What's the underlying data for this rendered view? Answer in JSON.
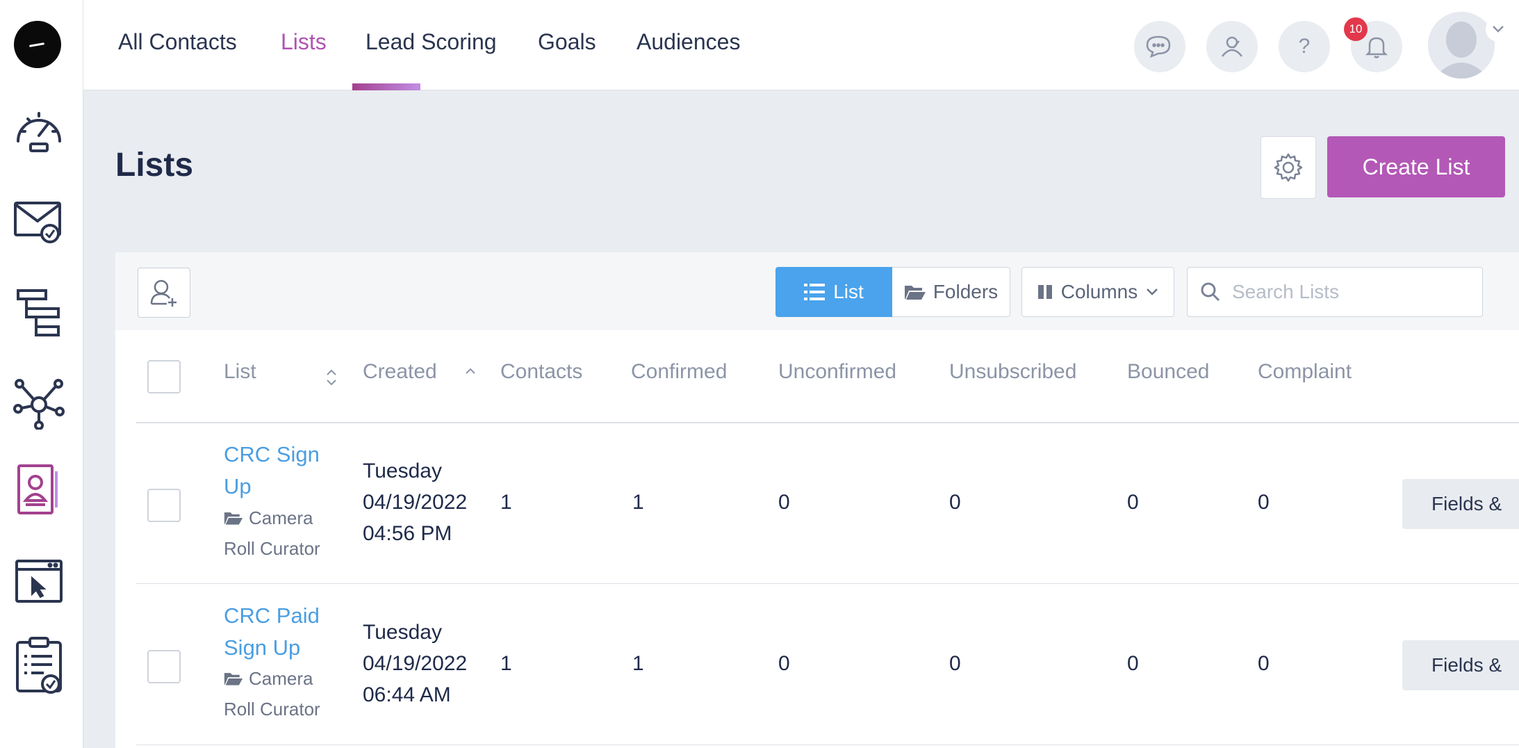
{
  "nav": {
    "tabs": [
      {
        "label": "All Contacts"
      },
      {
        "label": "Lists"
      },
      {
        "label": "Lead Scoring"
      },
      {
        "label": "Goals"
      },
      {
        "label": "Audiences"
      }
    ],
    "active_tab": "Lists",
    "notifications_count": "10",
    "help_label": "?"
  },
  "sidebar": {
    "items": [
      "dashboard-icon",
      "campaigns-icon",
      "automations-icon",
      "integrations-icon",
      "contacts-icon",
      "site-tracking-icon",
      "reports-icon"
    ],
    "active_item": "contacts-icon"
  },
  "header": {
    "title": "Lists",
    "create_label": "Create List"
  },
  "toolbar": {
    "list_label": "List",
    "folders_label": "Folders",
    "columns_label": "Columns",
    "search_placeholder": "Search Lists"
  },
  "table": {
    "columns": [
      "List",
      "Created",
      "Contacts",
      "Confirmed",
      "Unconfirmed",
      "Unsubscribed",
      "Bounced",
      "Complaint"
    ],
    "rows": [
      {
        "name_line1": "CRC Sign",
        "name_line2": "Up",
        "folder_line1": "Camera",
        "folder_line2": "Roll Curator",
        "created_day": "Tuesday",
        "created_date": "04/19/2022",
        "created_time": "04:56 PM",
        "contacts": "1",
        "confirmed": "1",
        "unconfirmed": "0",
        "unsubscribed": "0",
        "bounced": "0",
        "complaint": "0",
        "action": "Fields &"
      },
      {
        "name_line1": "CRC Paid",
        "name_line2": "Sign Up",
        "folder_line1": "Camera",
        "folder_line2": "Roll Curator",
        "created_day": "Tuesday",
        "created_date": "04/19/2022",
        "created_time": "06:44 AM",
        "contacts": "1",
        "confirmed": "1",
        "unconfirmed": "0",
        "unsubscribed": "0",
        "bounced": "0",
        "complaint": "0",
        "action": "Fields &"
      }
    ]
  },
  "colors": {
    "accent": "#b358b6",
    "primary_blue": "#4aa3ec",
    "link_blue": "#4a9ee2",
    "badge_red": "#e2384c"
  }
}
